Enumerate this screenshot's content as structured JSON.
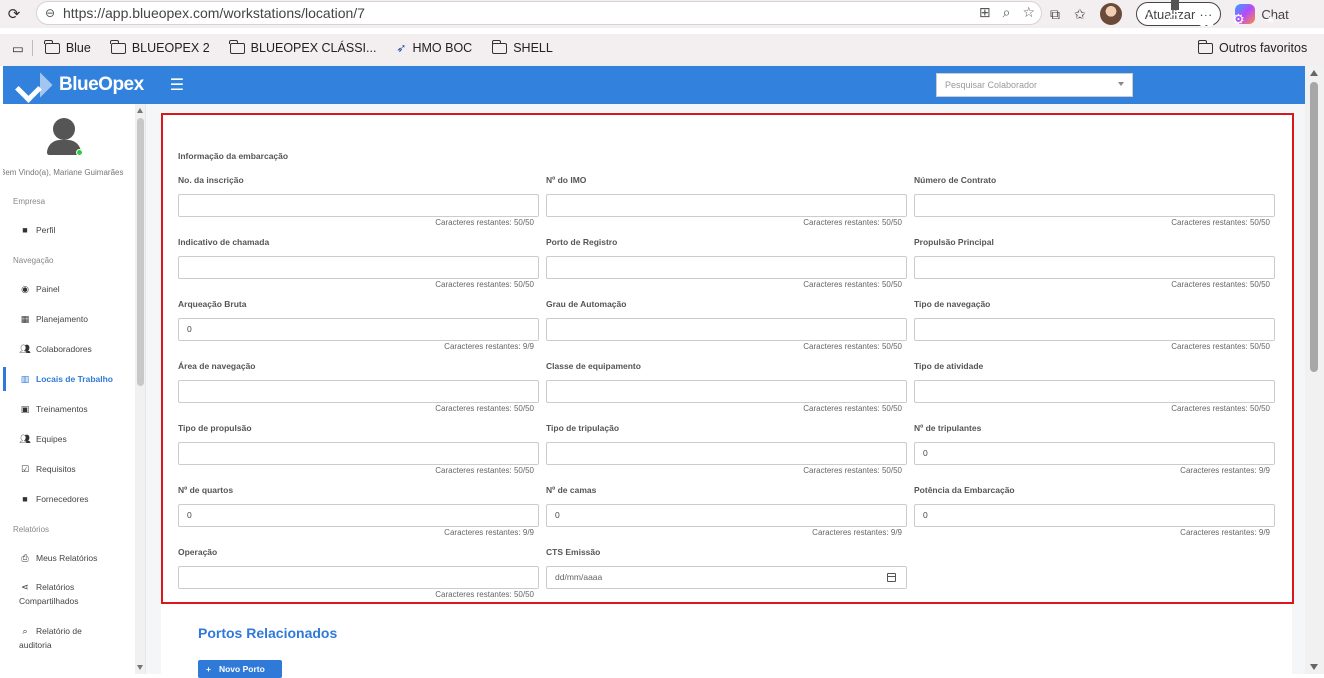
{
  "browser": {
    "url": "https://app.blueopex.com/workstations/location/7",
    "update_label": "Atualizar",
    "chat_label": "Chat",
    "bookmarks": [
      "Blue",
      "BLUEOPEX 2",
      "BLUEOPEX CLÁSSI...",
      "HMO BOC",
      "SHELL"
    ],
    "other_favorites": "Outros favoritos"
  },
  "header": {
    "brand": "BlueOpex",
    "search_placeholder": "Pesquisar Colaborador"
  },
  "sidebar": {
    "welcome": "Bem Vindo(a), Mariane Guimarães",
    "sections": {
      "empresa": "Empresa",
      "navegacao": "Navegação",
      "relatorios": "Relatórios"
    },
    "items": {
      "perfil": "Perfil",
      "painel": "Painel",
      "planejamento": "Planejamento",
      "colaboradores": "Colaboradores",
      "locais": "Locais de Trabalho",
      "treinamentos": "Treinamentos",
      "equipes": "Equipes",
      "requisitos": "Requisitos",
      "fornecedores": "Fornecedores",
      "meus_relatorios": "Meus Relatórios",
      "relatorios_compartilhados_1": "Relatórios",
      "relatorios_compartilhados_2": "Compartilhados",
      "relatorio_auditoria_1": "Relatório de",
      "relatorio_auditoria_2": "auditoria"
    }
  },
  "form": {
    "section_title": "Informação da embarcação",
    "fields": [
      {
        "label": "No. da inscrição",
        "value": "",
        "counter": "Caracteres restantes: 50/50"
      },
      {
        "label": "Nº do IMO",
        "value": "",
        "counter": "Caracteres restantes: 50/50"
      },
      {
        "label": "Número de Contrato",
        "value": "",
        "counter": "Caracteres restantes: 50/50"
      },
      {
        "label": "Indicativo de chamada",
        "value": "",
        "counter": "Caracteres restantes: 50/50"
      },
      {
        "label": "Porto de Registro",
        "value": "",
        "counter": "Caracteres restantes: 50/50"
      },
      {
        "label": "Propulsão Principal",
        "value": "",
        "counter": "Caracteres restantes: 50/50"
      },
      {
        "label": "Arqueação Bruta",
        "value": "0",
        "counter": "Caracteres restantes: 9/9"
      },
      {
        "label": "Grau de Automação",
        "value": "",
        "counter": "Caracteres restantes: 50/50"
      },
      {
        "label": "Tipo de navegação",
        "value": "",
        "counter": "Caracteres restantes: 50/50"
      },
      {
        "label": "Área de navegação",
        "value": "",
        "counter": "Caracteres restantes: 50/50"
      },
      {
        "label": "Classe de equipamento",
        "value": "",
        "counter": "Caracteres restantes: 50/50"
      },
      {
        "label": "Tipo de atividade",
        "value": "",
        "counter": "Caracteres restantes: 50/50"
      },
      {
        "label": "Tipo de propulsão",
        "value": "",
        "counter": "Caracteres restantes: 50/50"
      },
      {
        "label": "Tipo de tripulação",
        "value": "",
        "counter": "Caracteres restantes: 50/50"
      },
      {
        "label": "Nº de tripulantes",
        "value": "0",
        "counter": "Caracteres restantes: 9/9"
      },
      {
        "label": "Nº de quartos",
        "value": "0",
        "counter": "Caracteres restantes: 9/9"
      },
      {
        "label": "Nº de camas",
        "value": "0",
        "counter": "Caracteres restantes: 9/9"
      },
      {
        "label": "Potência da Embarcação",
        "value": "0",
        "counter": "Caracteres restantes: 9/9"
      },
      {
        "label": "Operação",
        "value": "",
        "counter": "Caracteres restantes: 50/50"
      },
      {
        "label": "CTS Emissão",
        "value": "dd/mm/aaaa",
        "counter": ""
      }
    ]
  },
  "related_ports": {
    "title": "Portos Relacionados",
    "new_port_button": "Novo Porto"
  },
  "colors": {
    "accent": "#3282dd",
    "highlight_border": "#d8181c"
  }
}
